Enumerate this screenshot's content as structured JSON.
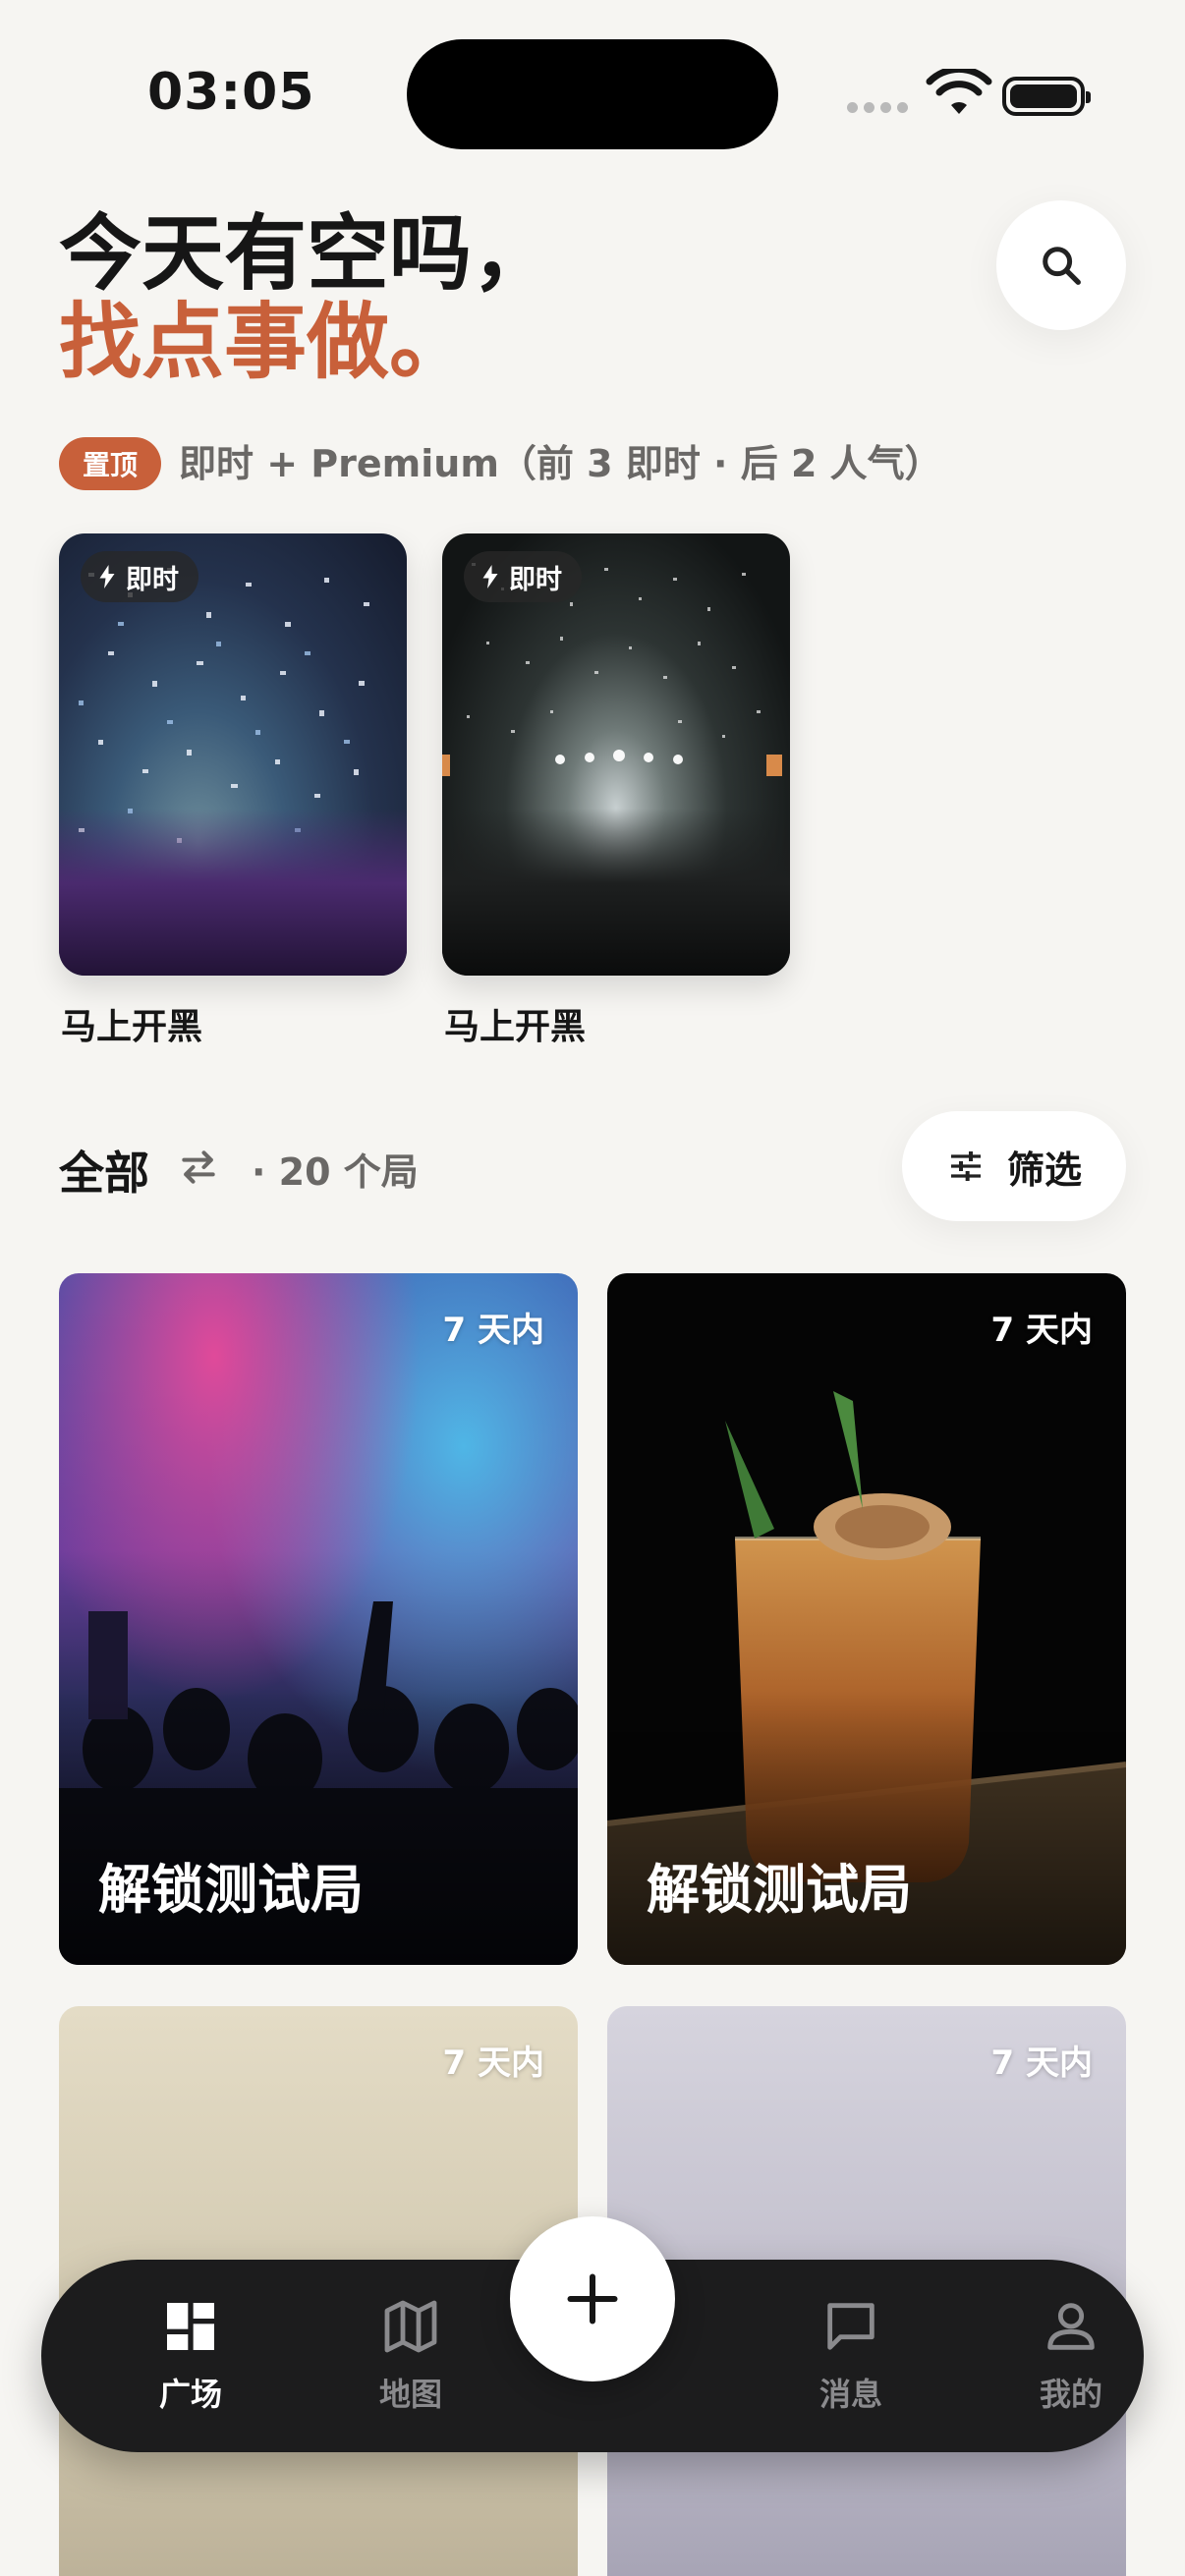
{
  "status_bar": {
    "time": "03:05"
  },
  "header": {
    "title_line1": "今天有空吗，",
    "title_line2": "找点事做。"
  },
  "pinned": {
    "badge": "置顶",
    "description": "即时 + Premium（前 3 即时 · 后 2 人气）",
    "cards": [
      {
        "tag": "即时",
        "caption": "马上开黑"
      },
      {
        "tag": "即时",
        "caption": "马上开黑"
      }
    ]
  },
  "section": {
    "title": "全部",
    "count": "· 20 个局",
    "filter_label": "筛选"
  },
  "grid": [
    {
      "tag": "7 天内",
      "caption": "解锁测试局"
    },
    {
      "tag": "7 天内",
      "caption": "解锁测试局"
    },
    {
      "tag": "7 天内",
      "caption": ""
    },
    {
      "tag": "7 天内",
      "caption": ""
    }
  ],
  "tabbar": {
    "items": [
      {
        "label": "广场",
        "icon": "grid-icon",
        "active": true
      },
      {
        "label": "地图",
        "icon": "map-icon",
        "active": false
      },
      {
        "label": "消息",
        "icon": "message-icon",
        "active": false
      },
      {
        "label": "我的",
        "icon": "profile-icon",
        "active": false
      }
    ],
    "fab_icon": "plus-icon"
  },
  "colors": {
    "accent": "#c8603a",
    "background": "#f6f5f2",
    "tabbar": "#1c1c1d"
  }
}
